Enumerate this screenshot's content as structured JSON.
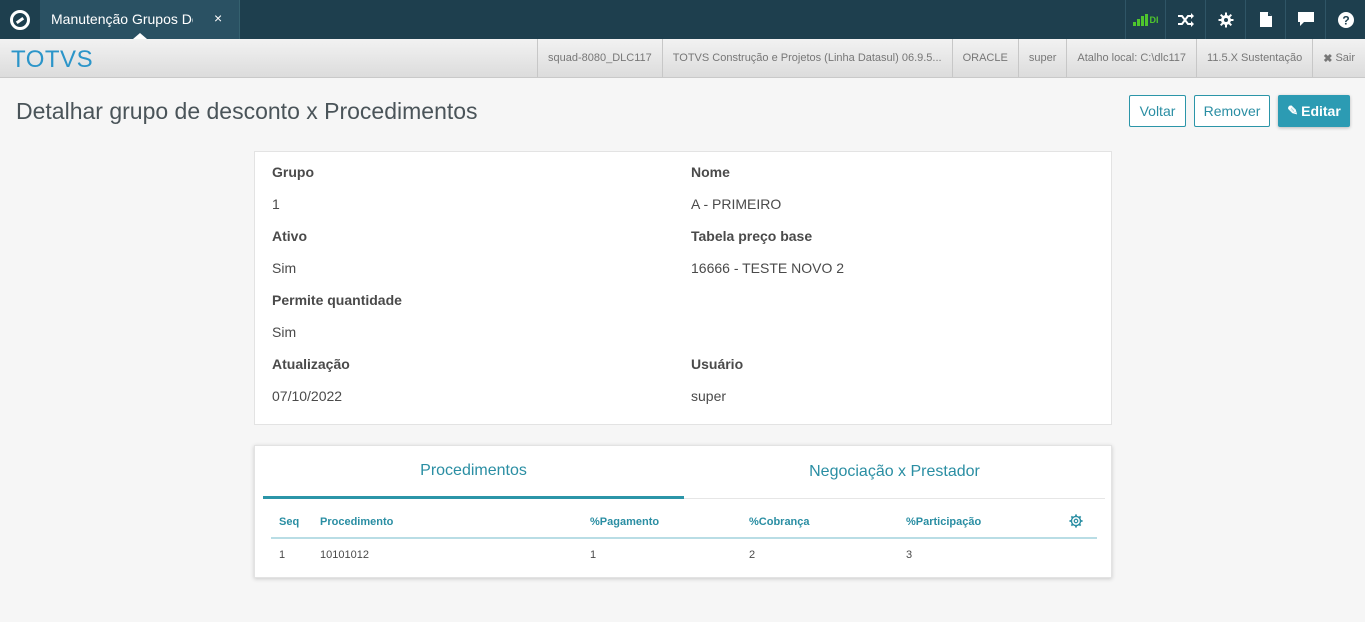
{
  "topbar": {
    "tab_label": "Manutenção Grupos De Desconto",
    "tab_close": "×",
    "signal_text": "DI",
    "icons": [
      "shuffle-icon",
      "gear-icon",
      "document-icon",
      "chat-icon",
      "help-icon"
    ]
  },
  "brandbar": {
    "brand": "TOTVS",
    "items": [
      "squad-8080_DLC117",
      "TOTVS Construção e Projetos (Linha Datasul) 06.9.5...",
      "ORACLE",
      "super",
      "Atalho local: C:\\dlc117",
      "11.5.X Sustentação"
    ],
    "logout": "Sair"
  },
  "page": {
    "title": "Detalhar grupo de desconto x Procedimentos",
    "buttons": {
      "back": "Voltar",
      "remove": "Remover",
      "edit": "Editar"
    }
  },
  "details": {
    "grupo_label": "Grupo",
    "grupo_value": "1",
    "nome_label": "Nome",
    "nome_value": "A - PRIMEIRO",
    "ativo_label": "Ativo",
    "ativo_value": "Sim",
    "tabela_label": "Tabela preço base",
    "tabela_value": "16666 - TESTE NOVO 2",
    "permite_label": "Permite quantidade",
    "permite_value": "Sim",
    "atualizacao_label": "Atualização",
    "atualizacao_value": "07/10/2022",
    "usuario_label": "Usuário",
    "usuario_value": "super"
  },
  "tabs": [
    "Procedimentos",
    "Negociação x Prestador"
  ],
  "table": {
    "columns": [
      "Seq",
      "Procedimento",
      "%Pagamento",
      "%Cobrança",
      "%Participação"
    ],
    "rows": [
      [
        "1",
        "10101012",
        "1",
        "2",
        "3"
      ]
    ]
  },
  "colors": {
    "accent": "#2b95a8",
    "topbar": "#1e3f4e",
    "brand": "#2b95c9"
  }
}
